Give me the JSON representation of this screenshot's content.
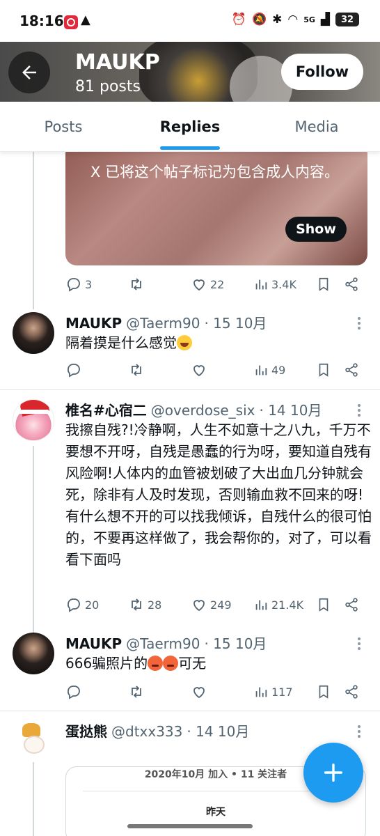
{
  "status_bar": {
    "time": "18:16",
    "battery": "32",
    "network": "5G"
  },
  "header": {
    "title": "MAUKP",
    "subtitle": "81 posts",
    "follow_label": "Follow"
  },
  "tabs": [
    {
      "label": "Posts"
    },
    {
      "label": "Replies"
    },
    {
      "label": "Media"
    }
  ],
  "media_card": {
    "warning": "X 已将这个帖子标记为包含成人内容。",
    "show_label": "Show"
  },
  "first_post_stats": {
    "replies": "3",
    "likes": "22",
    "views": "3.4K"
  },
  "posts": [
    {
      "name": "MAUKP",
      "handle": "@Taerm90",
      "date": "· 15 10月",
      "text": "隔着摸是什么感觉",
      "views": "49"
    },
    {
      "name": "椎名#心宿二",
      "handle": "@overdose_six",
      "date": "· 14 10月",
      "text": "我擦自残?!冷静啊，人生不如意十之八九，千万不要想不开呀，自残是愚蠢的行为呀，要知道自残有风险啊!人体内的血管被划破了大出血几分钟就会死，除非有人及时发现，否则输血救不回来的呀!有什么想不开的可以找我倾诉，自残什么的很可怕的，不要再这样做了，我会帮你的，对了，可以看看下面吗",
      "replies": "20",
      "retweets": "28",
      "likes": "249",
      "views": "21.4K"
    },
    {
      "name": "MAUKP",
      "handle": "@Taerm90",
      "date": "· 15 10月",
      "text_before": "666骗照片的",
      "text_after": "可无",
      "views": "117"
    },
    {
      "name": "蛋挞熊",
      "handle": "@dtxx333",
      "date": "· 14 10月"
    }
  ],
  "quote_card": {
    "line1": "2020年10月 加入 • 11 关注者",
    "line2": "昨天"
  }
}
